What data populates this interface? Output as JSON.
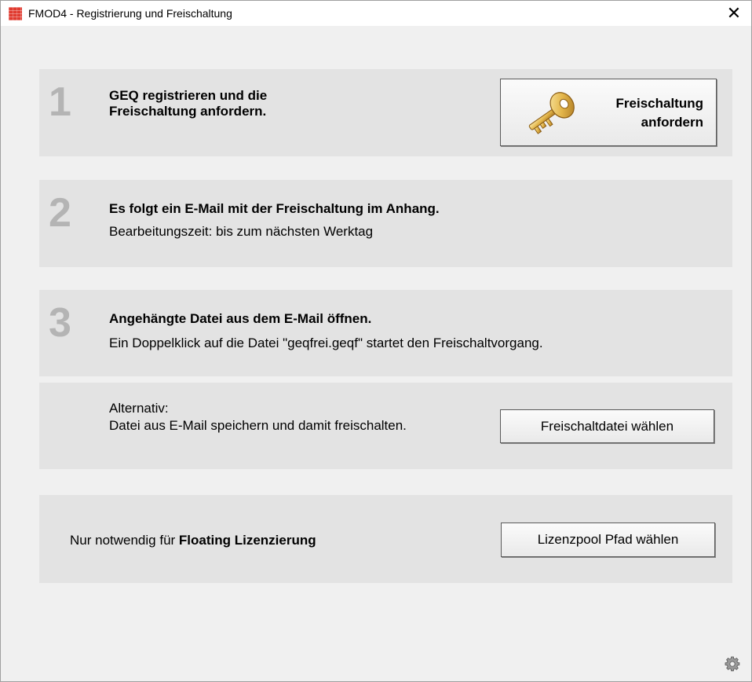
{
  "window": {
    "title": "FMOD4 - Registrierung und Freischaltung",
    "close_glyph": "✕",
    "icon": "fmod4-app-icon"
  },
  "step1": {
    "number": "1",
    "line1": "GEQ registrieren und die",
    "line2": "Freischaltung anfordern.",
    "button_line1": "Freischaltung",
    "button_line2": "anfordern",
    "button_icon": "key-icon"
  },
  "step2": {
    "number": "2",
    "heading": "Es folgt ein E-Mail mit der Freischaltung im Anhang.",
    "text": "Bearbeitungszeit: bis zum nächsten Werktag"
  },
  "step3": {
    "number": "3",
    "heading": "Angehängte Datei aus dem E-Mail öffnen.",
    "text": "Ein Doppelklick auf die Datei \"geqfrei.geqf\" startet den Freischaltvorgang."
  },
  "alternative": {
    "label": "Alternativ:",
    "text": "Datei aus E-Mail speichern und damit freischalten.",
    "button": "Freischaltdatei wählen"
  },
  "floating": {
    "text_prefix": "Nur notwendig für ",
    "text_bold": "Floating Lizenzierung",
    "button": "Lizenzpool Pfad wählen"
  },
  "footer": {
    "settings_icon": "gear-icon"
  }
}
